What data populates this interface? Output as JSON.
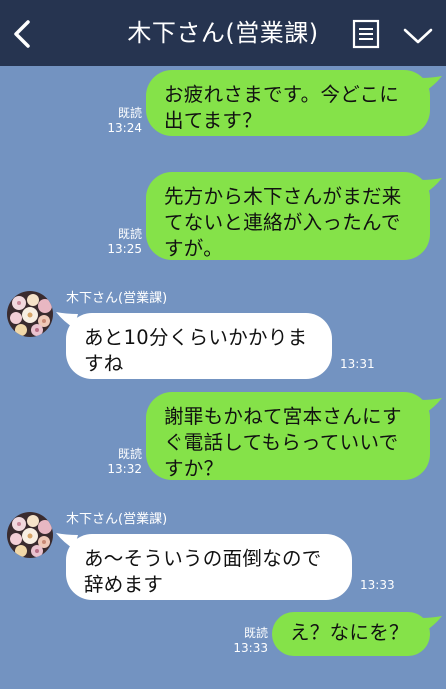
{
  "header": {
    "title": "木下さん(営業課)",
    "back_icon": "chevron-left-icon",
    "menu_icon": "memo-list-icon",
    "expand_icon": "chevron-down-icon"
  },
  "colors": {
    "background": "#7393c1",
    "header": "#263450",
    "outgoing_bubble": "#85e249",
    "incoming_bubble": "#ffffff"
  },
  "messages": [
    {
      "direction": "out",
      "lines": [
        "お疲れさまです。今どこに",
        "出てます？"
      ],
      "read": "既読",
      "time": "13:24"
    },
    {
      "direction": "out",
      "lines": [
        "先方から木下さんがまだ来",
        "てないと連絡が入ったんで",
        "すが。"
      ],
      "read": "既読",
      "time": "13:25"
    },
    {
      "direction": "in",
      "sender": "木下さん(営業課)",
      "lines": [
        "あと10分くらいかかりま",
        "すね"
      ],
      "time": "13:31"
    },
    {
      "direction": "out",
      "lines": [
        "謝罪もかねて宮本さんにす",
        "ぐ電話してもらっていいで",
        "すか？"
      ],
      "read": "既読",
      "time": "13:32"
    },
    {
      "direction": "in",
      "sender": "木下さん(営業課)",
      "lines": [
        "あ～そういうの面倒なので",
        "辞めます"
      ],
      "time": "13:33"
    },
    {
      "direction": "out",
      "lines": [
        "え？なにを？"
      ],
      "read": "既読",
      "time": "13:33"
    }
  ]
}
